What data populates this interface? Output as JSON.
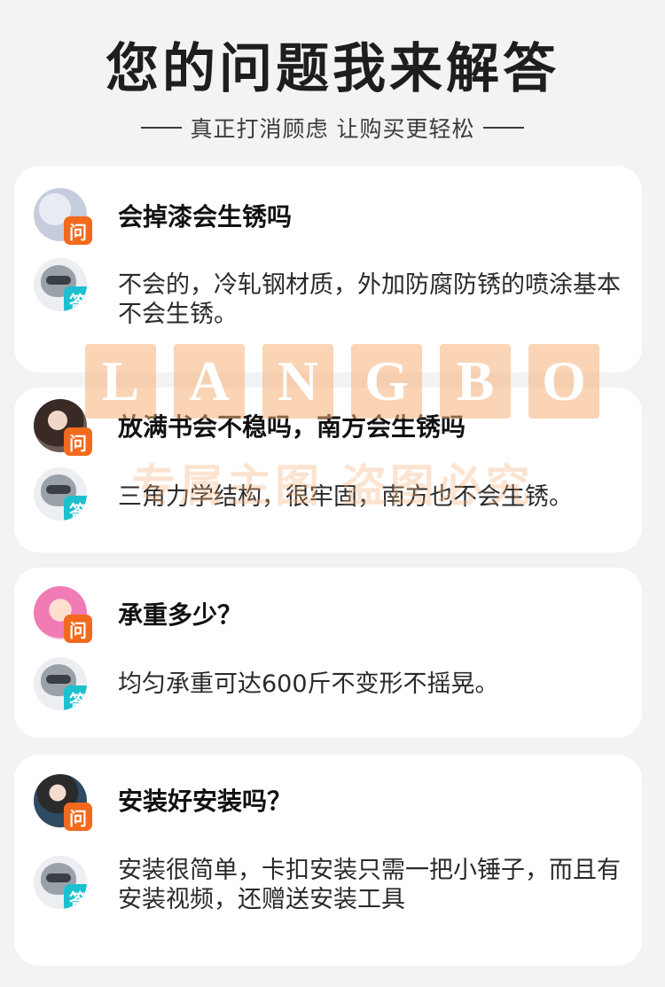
{
  "header": {
    "title": "您的问题我来解答",
    "subtitle": "真正打消顾虑 让购买更轻松"
  },
  "badges": {
    "question": "问",
    "answer": "答"
  },
  "watermark": {
    "letters": [
      "L",
      "A",
      "N",
      "G",
      "B",
      "O"
    ],
    "text": "专属主图 盗图必究"
  },
  "qa": [
    {
      "question": "会掉漆会生锈吗",
      "answer": "不会的，冷轧钢材质，外加防腐防锈的喷涂基本不会生锈。"
    },
    {
      "question": "放满书会不稳吗，南方会生锈吗",
      "answer": "三角力学结构，很牢固，南方也不会生锈。"
    },
    {
      "question": "承重多少？",
      "answer": "均匀承重可达600斤不变形不摇晃。"
    },
    {
      "question": "安装好安装吗？",
      "answer": "安装很简单，卡扣安装只需一把小锤子，而且有安装视频，还赠送安装工具"
    }
  ]
}
